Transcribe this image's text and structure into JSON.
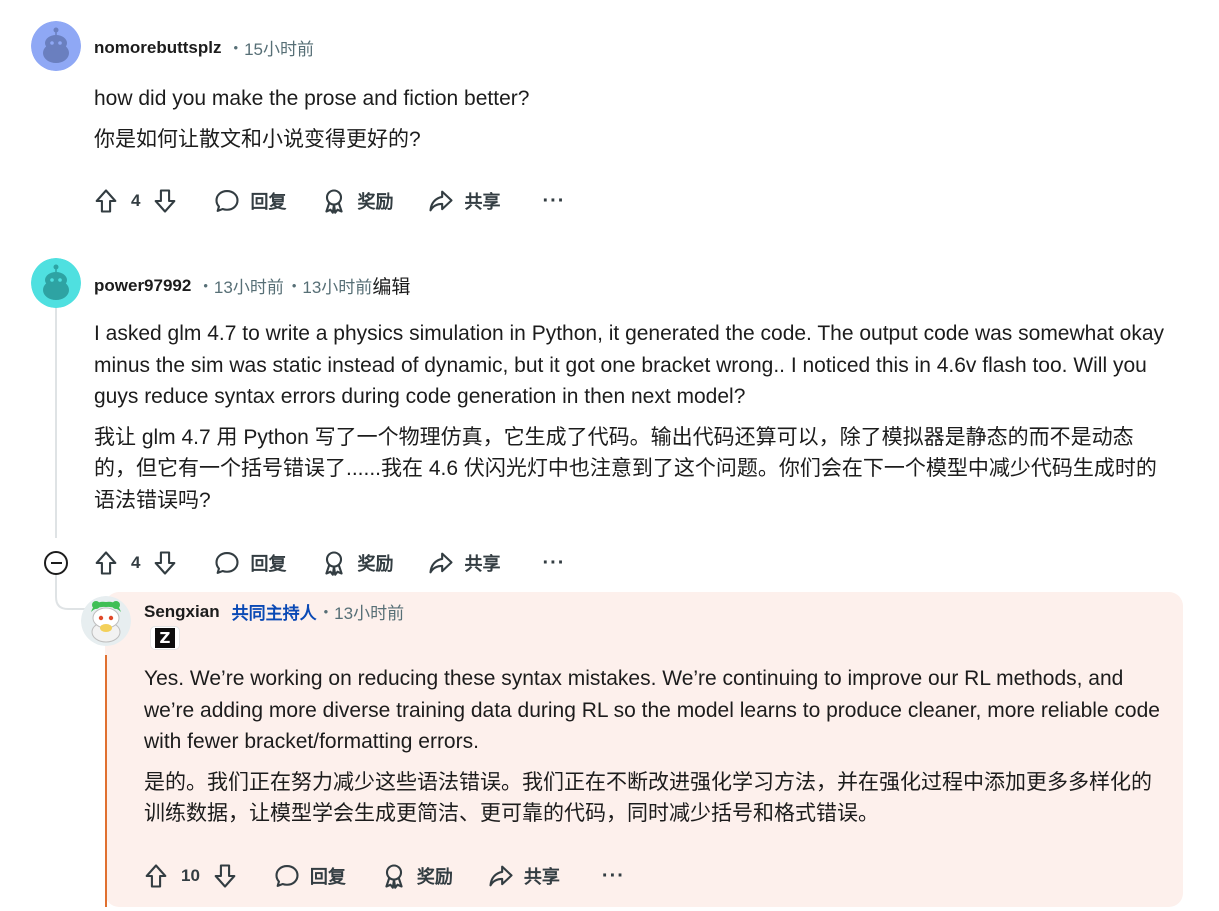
{
  "comments": [
    {
      "author": "nomorebuttsplz",
      "time": "15小时前",
      "paragraphs": [
        "how did you make the prose and fiction better?",
        "你是如何让散文和小说变得更好的?"
      ],
      "score": "4"
    },
    {
      "author": "power97992",
      "time": "13小时前",
      "edited_time": "13小时前",
      "edited_label": "编辑",
      "paragraphs": [
        "I asked glm 4.7 to write a physics simulation in Python, it generated the code. The output code was somewhat okay minus the sim was static instead of dynamic, but it got one bracket wrong.. I noticed this in 4.6v flash too. Will you guys reduce syntax errors during code generation in then next model?",
        "我让 glm 4.7 用 Python 写了一个物理仿真，它生成了代码。输出代码还算可以，除了模拟器是静态的而不是动态的，但它有一个括号错误了......我在 4.6 伏闪光灯中也注意到了这个问题。你们会在下一个模型中减少代码生成时的语法错误吗?"
      ],
      "score": "4"
    },
    {
      "author": "Sengxian",
      "mod_label": "共同主持人",
      "time": "13小时前",
      "flair": "Z",
      "paragraphs": [
        "Yes. We’re working on reducing these syntax mistakes. We’re continuing to improve our RL methods, and we’re adding more diverse training data during RL so the model learns to produce cleaner, more reliable code with fewer bracket/formatting errors.",
        "是的。我们正在努力减少这些语法错误。我们正在不断改进强化学习方法，并在强化过程中添加更多多样化的训练数据，让模型学会生成更简洁、更可靠的代码，同时减少括号和格式错误。"
      ],
      "score": "10"
    }
  ],
  "actions": {
    "reply": "回复",
    "award": "奖励",
    "share": "共享",
    "more": "···"
  },
  "colors": {
    "mod_blue": "#0a49b5",
    "highlight_bg": "#fdf0ec",
    "mod_bar": "#e07030",
    "meta_gray": "#576f76"
  },
  "icons": [
    "upvote-icon",
    "downvote-icon",
    "reply-icon",
    "award-icon",
    "share-icon",
    "more-icon",
    "collapse-icon"
  ]
}
